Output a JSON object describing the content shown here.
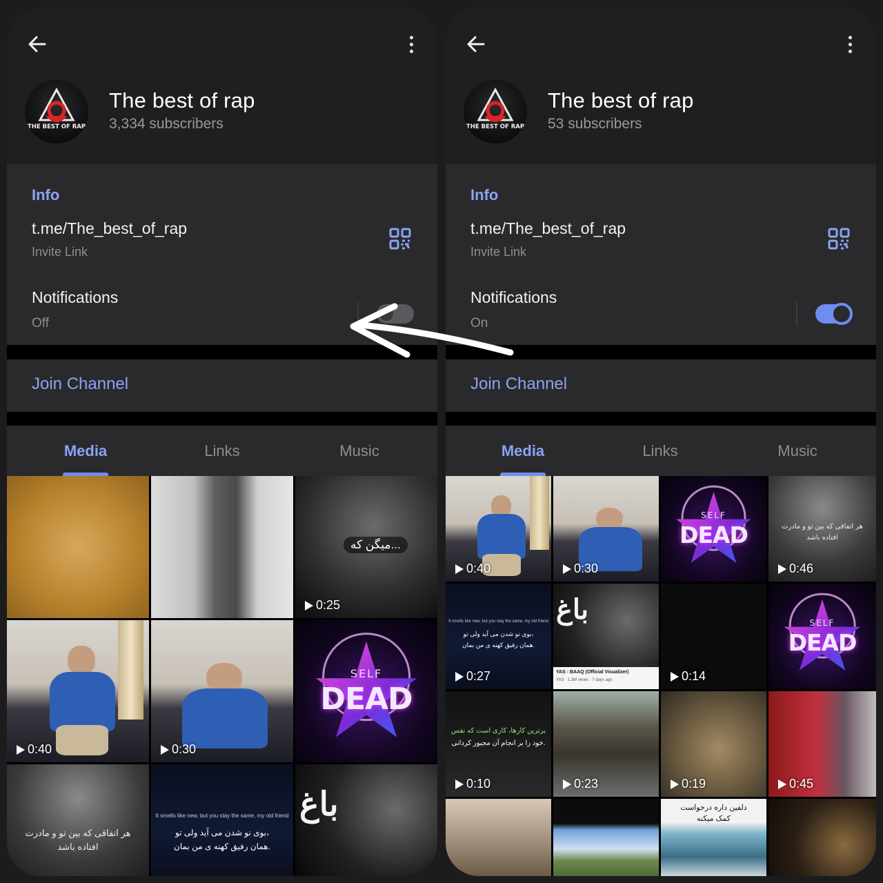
{
  "left": {
    "channel_name": "The best of rap",
    "subscribers": "3,334 subscribers",
    "info_title": "Info",
    "invite_link": "t.me/The_best_of_rap",
    "invite_label": "Invite Link",
    "notifications_label": "Notifications",
    "notifications_state": "Off",
    "join_label": "Join Channel",
    "tabs": [
      "Media",
      "Links",
      "Music"
    ],
    "durations": [
      "0:25",
      "0:40",
      "0:30"
    ],
    "captions": {
      "face_caption": "میگن که...",
      "quote_title": "It smells like new, but you stay the same, my old friend",
      "quote_line1": "بوی نو شدن می آید ولی تو،",
      "quote_line2": "همان رفیق کهنه ی من بمان.",
      "mom_line1": "هر اتفاقی که بین تو و مادرت",
      "mom_line2": "افتاده باشد",
      "dead_small": "SELF",
      "dead_word": "DEAD",
      "baq_word": "باغ"
    }
  },
  "right": {
    "channel_name": "The best of rap",
    "subscribers": "53 subscribers",
    "info_title": "Info",
    "invite_link": "t.me/The_best_of_rap",
    "invite_label": "Invite Link",
    "notifications_label": "Notifications",
    "notifications_state": "On",
    "join_label": "Join Channel",
    "tabs": [
      "Media",
      "Links",
      "Music"
    ],
    "durations": [
      "0:40",
      "0:30",
      "0:46",
      "0:27",
      "0:14",
      "0:10",
      "0:23",
      "0:19",
      "0:45"
    ],
    "captions": {
      "dead_small": "SELF",
      "dead_word": "DEAD",
      "mom_line1": "هر اتفاقی که بین تو و مادرت",
      "mom_line2": "افتاده باشد",
      "quote_title": "It smells like new, but you stay the same, my old friend",
      "quote_line1": "بوی نو شدن می آید ولی تو،",
      "quote_line2": "همان رفیق کهنه ی من بمان.",
      "yt_title": "YAS - BAAQ (Official Visualizer)",
      "yt_meta": "YAS · 1.3M views · 7 days ago",
      "baq_word": "باغ",
      "work_line1": "برترین کارها، کاری است که نفس",
      "work_line2": "خود را بر انجام آن مجبور کردانی.",
      "dolphin_line1": "دلفین داره درخواست",
      "dolphin_line2": "کمک میکنه"
    }
  },
  "logo_text": "THE BEST OF RAP",
  "colors": {
    "accent": "#8aa4f5",
    "toggle_on": "#6f8cf0",
    "card": "#2a2a2c"
  }
}
